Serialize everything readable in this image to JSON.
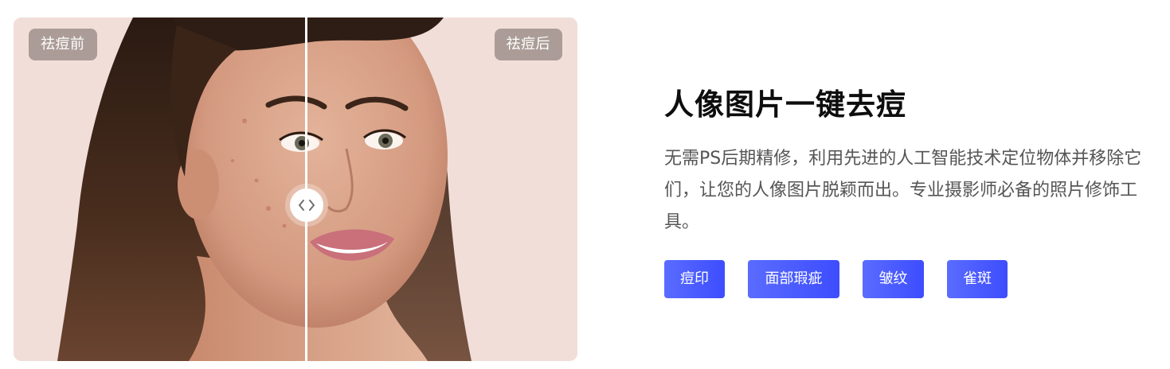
{
  "compare": {
    "before_label": "祛痘前",
    "after_label": "祛痘后",
    "split_position_percent": 52,
    "handle_icon": "chevron-left-right-icon",
    "background_color": "#f1ded9"
  },
  "feature": {
    "title": "人像图片一键去痘",
    "description": "无需PS后期精修，利用先进的人工智能技术定位物体并移除它们，让您的人像图片脱颖而出。专业摄影师必备的照片修饰工具。",
    "tags": [
      "痘印",
      "面部瑕疵",
      "皱纹",
      "雀斑"
    ]
  },
  "colors": {
    "accent_start": "#5a6cff",
    "accent_end": "#3d4dff",
    "title": "#0d0d0d",
    "body_text": "#555555",
    "label_background": "#786c68"
  }
}
